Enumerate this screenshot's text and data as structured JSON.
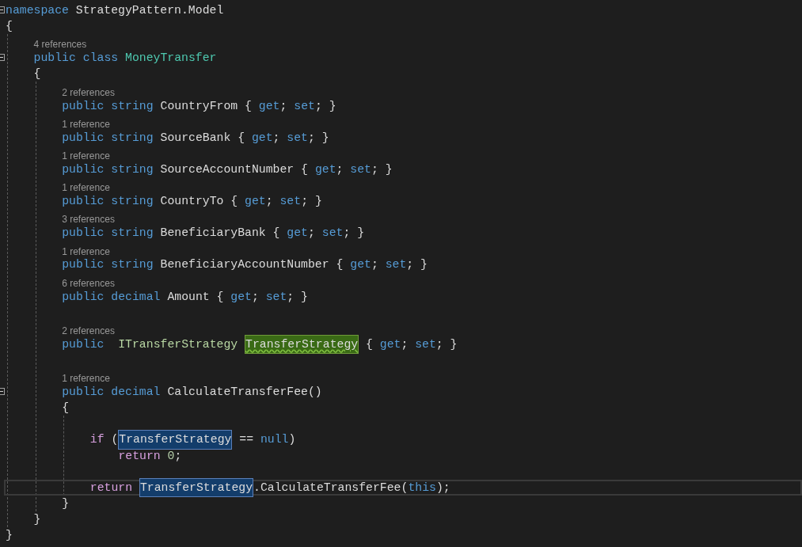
{
  "editor": {
    "items": [
      {
        "kind": "line",
        "fold": true,
        "tokens": [
          {
            "kind": "keyword",
            "text": "namespace "
          },
          {
            "kind": "ident",
            "text": "StrategyPattern.Model"
          }
        ]
      },
      {
        "kind": "line",
        "tokens": [
          {
            "kind": "punct",
            "text": "{"
          }
        ]
      },
      {
        "kind": "block",
        "guides": true,
        "children": [
          {
            "kind": "codelens",
            "text": "4 references"
          },
          {
            "kind": "line",
            "fold": true,
            "tokens": [
              {
                "kind": "keyword",
                "text": "public class "
              },
              {
                "kind": "class",
                "text": "MoneyTransfer"
              }
            ]
          },
          {
            "kind": "line",
            "tokens": [
              {
                "kind": "punct",
                "text": "{"
              }
            ]
          },
          {
            "kind": "block",
            "guides": true,
            "children": [
              {
                "kind": "codelens",
                "text": "2 references"
              },
              {
                "kind": "line",
                "tokens": [
                  {
                    "kind": "keyword",
                    "text": "public string "
                  },
                  {
                    "kind": "ident",
                    "text": "CountryFrom { "
                  },
                  {
                    "kind": "keyword",
                    "text": "get"
                  },
                  {
                    "kind": "punct",
                    "text": "; "
                  },
                  {
                    "kind": "keyword",
                    "text": "set"
                  },
                  {
                    "kind": "punct",
                    "text": "; }"
                  }
                ]
              },
              {
                "kind": "codelens",
                "text": "1 reference"
              },
              {
                "kind": "line",
                "tokens": [
                  {
                    "kind": "keyword",
                    "text": "public string "
                  },
                  {
                    "kind": "ident",
                    "text": "SourceBank { "
                  },
                  {
                    "kind": "keyword",
                    "text": "get"
                  },
                  {
                    "kind": "punct",
                    "text": "; "
                  },
                  {
                    "kind": "keyword",
                    "text": "set"
                  },
                  {
                    "kind": "punct",
                    "text": "; }"
                  }
                ]
              },
              {
                "kind": "codelens",
                "text": "1 reference"
              },
              {
                "kind": "line",
                "tokens": [
                  {
                    "kind": "keyword",
                    "text": "public string "
                  },
                  {
                    "kind": "ident",
                    "text": "SourceAccountNumber { "
                  },
                  {
                    "kind": "keyword",
                    "text": "get"
                  },
                  {
                    "kind": "punct",
                    "text": "; "
                  },
                  {
                    "kind": "keyword",
                    "text": "set"
                  },
                  {
                    "kind": "punct",
                    "text": "; }"
                  }
                ]
              },
              {
                "kind": "codelens",
                "text": "1 reference"
              },
              {
                "kind": "line",
                "tokens": [
                  {
                    "kind": "keyword",
                    "text": "public string "
                  },
                  {
                    "kind": "ident",
                    "text": "CountryTo { "
                  },
                  {
                    "kind": "keyword",
                    "text": "get"
                  },
                  {
                    "kind": "punct",
                    "text": "; "
                  },
                  {
                    "kind": "keyword",
                    "text": "set"
                  },
                  {
                    "kind": "punct",
                    "text": "; }"
                  }
                ]
              },
              {
                "kind": "codelens",
                "text": "3 references"
              },
              {
                "kind": "line",
                "tokens": [
                  {
                    "kind": "keyword",
                    "text": "public string "
                  },
                  {
                    "kind": "ident",
                    "text": "BeneficiaryBank { "
                  },
                  {
                    "kind": "keyword",
                    "text": "get"
                  },
                  {
                    "kind": "punct",
                    "text": "; "
                  },
                  {
                    "kind": "keyword",
                    "text": "set"
                  },
                  {
                    "kind": "punct",
                    "text": "; }"
                  }
                ]
              },
              {
                "kind": "codelens",
                "text": "1 reference"
              },
              {
                "kind": "line",
                "tokens": [
                  {
                    "kind": "keyword",
                    "text": "public string "
                  },
                  {
                    "kind": "ident",
                    "text": "BeneficiaryAccountNumber { "
                  },
                  {
                    "kind": "keyword",
                    "text": "get"
                  },
                  {
                    "kind": "punct",
                    "text": "; "
                  },
                  {
                    "kind": "keyword",
                    "text": "set"
                  },
                  {
                    "kind": "punct",
                    "text": "; }"
                  }
                ]
              },
              {
                "kind": "codelens",
                "text": "6 references"
              },
              {
                "kind": "line",
                "tokens": [
                  {
                    "kind": "keyword",
                    "text": "public decimal "
                  },
                  {
                    "kind": "ident",
                    "text": "Amount { "
                  },
                  {
                    "kind": "keyword",
                    "text": "get"
                  },
                  {
                    "kind": "punct",
                    "text": "; "
                  },
                  {
                    "kind": "keyword",
                    "text": "set"
                  },
                  {
                    "kind": "punct",
                    "text": "; }"
                  }
                ]
              },
              {
                "kind": "blank"
              },
              {
                "kind": "codelens",
                "text": "2 references"
              },
              {
                "kind": "line",
                "tokens": [
                  {
                    "kind": "keyword",
                    "text": "public  "
                  },
                  {
                    "kind": "interface",
                    "text": "ITransferStrategy "
                  },
                  {
                    "kind": "ident",
                    "text": "TransferStrategy",
                    "highlighted": true,
                    "definition": true,
                    "squiggle": true
                  },
                  {
                    "kind": "punct",
                    "text": " { "
                  },
                  {
                    "kind": "keyword",
                    "text": "get"
                  },
                  {
                    "kind": "punct",
                    "text": "; "
                  },
                  {
                    "kind": "keyword",
                    "text": "set"
                  },
                  {
                    "kind": "punct",
                    "text": "; }"
                  }
                ]
              },
              {
                "kind": "blank"
              },
              {
                "kind": "codelens",
                "text": "1 reference"
              },
              {
                "kind": "line",
                "fold": true,
                "tokens": [
                  {
                    "kind": "keyword",
                    "text": "public decimal "
                  },
                  {
                    "kind": "ident",
                    "text": "CalculateTransferFee()"
                  }
                ]
              },
              {
                "kind": "line",
                "tokens": [
                  {
                    "kind": "punct",
                    "text": "{"
                  }
                ]
              },
              {
                "kind": "block",
                "guides": true,
                "children": [
                  {
                    "kind": "blank"
                  },
                  {
                    "kind": "line",
                    "tokens": [
                      {
                        "kind": "control",
                        "text": "if "
                      },
                      {
                        "kind": "punct",
                        "text": "("
                      },
                      {
                        "kind": "ident",
                        "text": "TransferStrategy",
                        "highlighted": true,
                        "definition": false
                      },
                      {
                        "kind": "punct",
                        "text": " == "
                      },
                      {
                        "kind": "keyword",
                        "text": "null"
                      },
                      {
                        "kind": "punct",
                        "text": ")"
                      }
                    ]
                  },
                  {
                    "kind": "block",
                    "guides": false,
                    "children": [
                      {
                        "kind": "line",
                        "tokens": [
                          {
                            "kind": "control",
                            "text": "return "
                          },
                          {
                            "kind": "number",
                            "text": "0"
                          },
                          {
                            "kind": "punct",
                            "text": ";"
                          }
                        ]
                      }
                    ]
                  },
                  {
                    "kind": "blank"
                  },
                  {
                    "kind": "line",
                    "current": true,
                    "tokens": [
                      {
                        "kind": "control",
                        "text": "return "
                      },
                      {
                        "kind": "ident",
                        "text": "TransferStrategy",
                        "highlighted": true,
                        "definition": false
                      },
                      {
                        "kind": "ident",
                        "text": ".CalculateTransferFee("
                      },
                      {
                        "kind": "keyword",
                        "text": "this"
                      },
                      {
                        "kind": "punct",
                        "text": ");"
                      }
                    ]
                  }
                ]
              },
              {
                "kind": "line",
                "tokens": [
                  {
                    "kind": "punct",
                    "text": "}"
                  }
                ]
              }
            ]
          },
          {
            "kind": "line",
            "tokens": [
              {
                "kind": "punct",
                "text": "}"
              }
            ]
          }
        ]
      },
      {
        "kind": "line",
        "tokens": [
          {
            "kind": "punct",
            "text": "}"
          }
        ]
      }
    ]
  }
}
